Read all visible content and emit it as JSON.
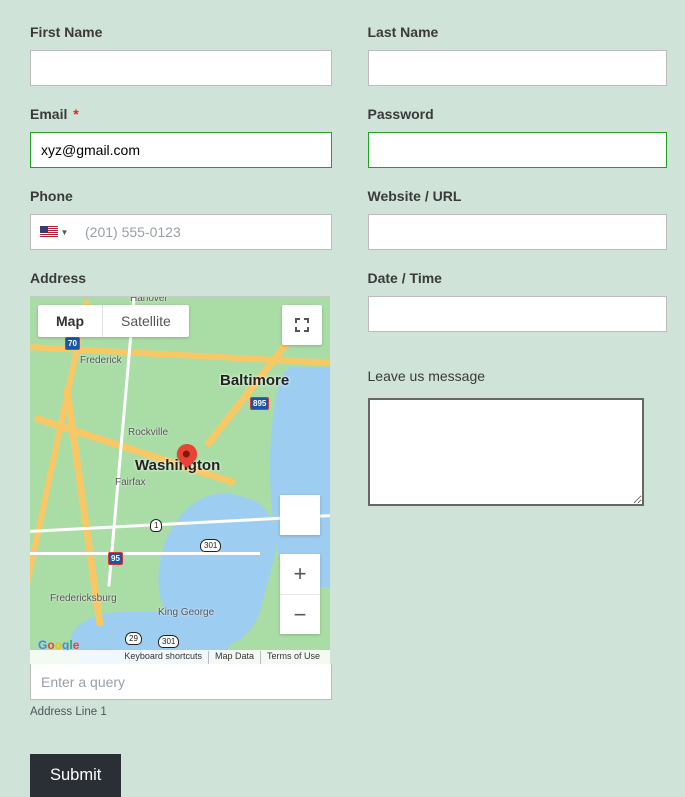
{
  "fields": {
    "first_name": {
      "label": "First Name",
      "value": ""
    },
    "last_name": {
      "label": "Last Name",
      "value": ""
    },
    "email": {
      "label": "Email",
      "required_marker": "*",
      "value": "xyz@gmail.com"
    },
    "password": {
      "label": "Password",
      "value": ""
    },
    "phone": {
      "label": "Phone",
      "placeholder": "(201) 555-0123",
      "value": "",
      "country_code": "US"
    },
    "website": {
      "label": "Website / URL",
      "value": ""
    },
    "address": {
      "label": "Address",
      "query_placeholder": "Enter a query",
      "query_value": "",
      "sublabel": "Address Line 1"
    },
    "datetime": {
      "label": "Date / Time",
      "value": ""
    },
    "message": {
      "label": "Leave us message",
      "value": ""
    }
  },
  "map": {
    "tabs": {
      "map": "Map",
      "satellite": "Satellite"
    },
    "attribution": {
      "shortcuts": "Keyboard shortcuts",
      "data": "Map Data",
      "terms": "Terms of Use"
    },
    "logo": "Google",
    "cities": {
      "baltimore": "Baltimore",
      "washington": "Washington"
    },
    "towns": {
      "frederick": "Frederick",
      "rockville": "Rockville",
      "fairfax": "Fairfax",
      "fredericksburg": "Fredericksburg",
      "king_george": "King George",
      "hanover": "Hanover"
    },
    "shields": {
      "i70": "70",
      "i895": "895",
      "i95": "95",
      "us1": "1",
      "us301a": "301",
      "us29": "29",
      "us301b": "301"
    },
    "zoom": {
      "plus": "+",
      "minus": "−"
    }
  },
  "buttons": {
    "submit": "Submit"
  }
}
